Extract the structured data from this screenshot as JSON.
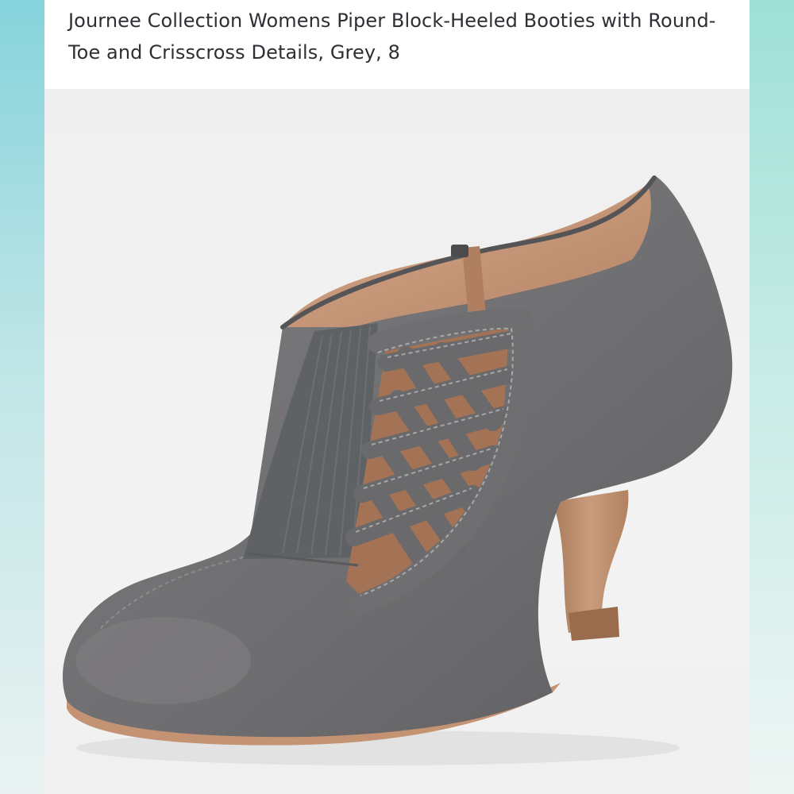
{
  "product": {
    "title": "Journee Collection Womens Piper Block-Heeled Booties with Round-Toe and Crisscross Details, Grey, 8"
  },
  "colors": {
    "suede": "#6f6e70",
    "lining": "#c79a7d",
    "heel": "#b88a6a",
    "sole": "#c49373",
    "elastic": "#5f6264"
  }
}
